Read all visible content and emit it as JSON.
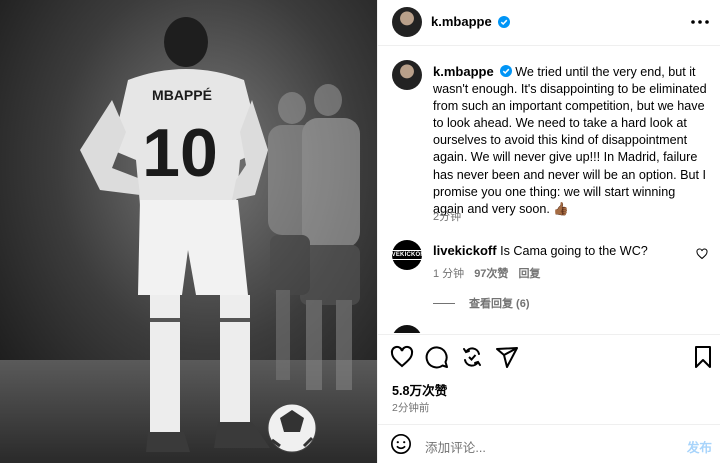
{
  "post": {
    "photo_alt": "Player in number 10 white kit, hands on hips, standing beside a football",
    "jersey_name": "MBAPPÉ",
    "jersey_number": "10"
  },
  "header": {
    "username": "k.mbappe",
    "verified_icon": "verified-badge-icon",
    "more_icon": "more-options-icon"
  },
  "caption": {
    "username": "k.mbappe",
    "text": "We tried until the very end, but it wasn't enough. It's disappointing to be eliminated from such an important competition, but we have to look ahead. We need to take a hard look at ourselves to avoid this kind of disappointment again. We will never give up!!! In Madrid, failure has never been and never will be an option. But I promise you one thing: we will start winning again and very soon. 👍🏾",
    "time": "2分钟"
  },
  "comment": {
    "username": "livekickoff",
    "avatar_text": "LIVEKICKOFF",
    "text": "Is Cama going to the WC?",
    "time": "1 分钟",
    "likes": "97次赞",
    "reply_label": "回复",
    "view_replies": "查看回复 (6)"
  },
  "actions": {
    "likes": "5.8万次赞",
    "posted": "2分钟前"
  },
  "add_comment": {
    "placeholder": "添加评论...",
    "post_label": "发布"
  },
  "colors": {
    "verified": "#0095f6",
    "muted": "#737373",
    "post_disabled": "#a8d4fb"
  }
}
